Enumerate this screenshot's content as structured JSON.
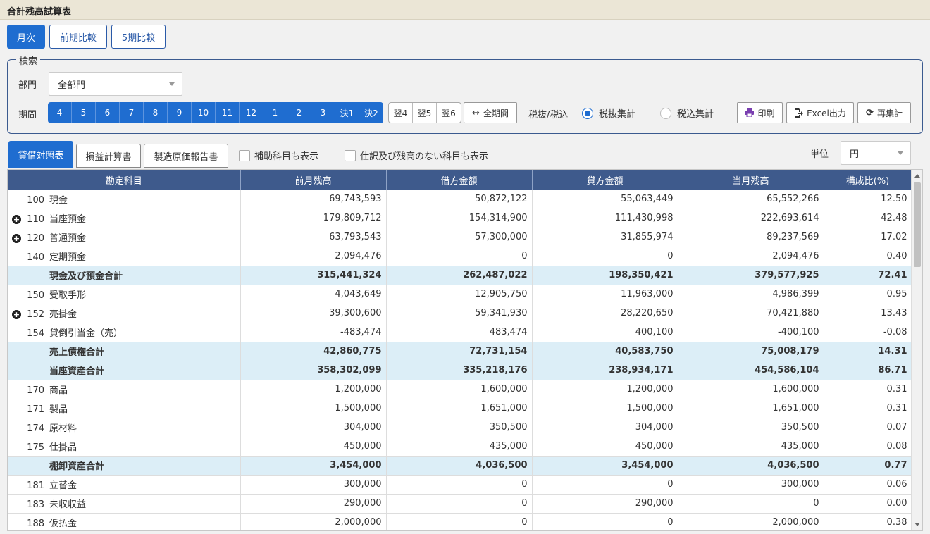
{
  "title": "合計残高試算表",
  "view_tabs": [
    "月次",
    "前期比較",
    "5期比較"
  ],
  "search": {
    "legend": "検索",
    "department_label": "部門",
    "department_value": "全部門",
    "period_label": "期間",
    "periods": [
      "4",
      "5",
      "6",
      "7",
      "8",
      "9",
      "10",
      "11",
      "12",
      "1",
      "2",
      "3",
      "決1",
      "決2"
    ],
    "periods_next": [
      "翌4",
      "翌5",
      "翌6"
    ],
    "all_period_label": "全期間",
    "tax_label": "税抜/税込",
    "tax_options": [
      "税抜集計",
      "税込集計"
    ],
    "tax_selected": 0,
    "print_label": "印刷",
    "excel_label": "Excel出力",
    "recalc_label": "再集計"
  },
  "report_tabs": [
    "貸借対照表",
    "損益計算書",
    "製造原価報告書"
  ],
  "options": {
    "sub_accounts": "補助科目も表示",
    "no_journal": "仕訳及び残高のない科目も表示"
  },
  "unit": {
    "label": "単位",
    "value": "円"
  },
  "table": {
    "headers": [
      "勘定科目",
      "前月残高",
      "借方金額",
      "貸方金額",
      "当月残高",
      "構成比(%)"
    ],
    "rows": [
      {
        "code": "100",
        "name": "現金",
        "expand": false,
        "subtotal": false,
        "values": [
          "69,743,593",
          "50,872,122",
          "55,063,449",
          "65,552,266",
          "12.50"
        ]
      },
      {
        "code": "110",
        "name": "当座預金",
        "expand": true,
        "subtotal": false,
        "values": [
          "179,809,712",
          "154,314,900",
          "111,430,998",
          "222,693,614",
          "42.48"
        ]
      },
      {
        "code": "120",
        "name": "普通預金",
        "expand": true,
        "subtotal": false,
        "values": [
          "63,793,543",
          "57,300,000",
          "31,855,974",
          "89,237,569",
          "17.02"
        ]
      },
      {
        "code": "140",
        "name": "定期預金",
        "expand": false,
        "subtotal": false,
        "values": [
          "2,094,476",
          "0",
          "0",
          "2,094,476",
          "0.40"
        ]
      },
      {
        "code": "",
        "name": "現金及び預金合計",
        "expand": false,
        "subtotal": true,
        "values": [
          "315,441,324",
          "262,487,022",
          "198,350,421",
          "379,577,925",
          "72.41"
        ]
      },
      {
        "code": "150",
        "name": "受取手形",
        "expand": false,
        "subtotal": false,
        "values": [
          "4,043,649",
          "12,905,750",
          "11,963,000",
          "4,986,399",
          "0.95"
        ]
      },
      {
        "code": "152",
        "name": "売掛金",
        "expand": true,
        "subtotal": false,
        "values": [
          "39,300,600",
          "59,341,930",
          "28,220,650",
          "70,421,880",
          "13.43"
        ]
      },
      {
        "code": "154",
        "name": "貸倒引当金（売）",
        "expand": false,
        "subtotal": false,
        "values": [
          "-483,474",
          "483,474",
          "400,100",
          "-400,100",
          "-0.08"
        ]
      },
      {
        "code": "",
        "name": "売上債権合計",
        "expand": false,
        "subtotal": true,
        "values": [
          "42,860,775",
          "72,731,154",
          "40,583,750",
          "75,008,179",
          "14.31"
        ]
      },
      {
        "code": "",
        "name": "当座資産合計",
        "expand": false,
        "subtotal": true,
        "values": [
          "358,302,099",
          "335,218,176",
          "238,934,171",
          "454,586,104",
          "86.71"
        ]
      },
      {
        "code": "170",
        "name": "商品",
        "expand": false,
        "subtotal": false,
        "values": [
          "1,200,000",
          "1,600,000",
          "1,200,000",
          "1,600,000",
          "0.31"
        ]
      },
      {
        "code": "171",
        "name": "製品",
        "expand": false,
        "subtotal": false,
        "values": [
          "1,500,000",
          "1,651,000",
          "1,500,000",
          "1,651,000",
          "0.31"
        ]
      },
      {
        "code": "174",
        "name": "原材料",
        "expand": false,
        "subtotal": false,
        "values": [
          "304,000",
          "350,500",
          "304,000",
          "350,500",
          "0.07"
        ]
      },
      {
        "code": "175",
        "name": "仕掛品",
        "expand": false,
        "subtotal": false,
        "values": [
          "450,000",
          "435,000",
          "450,000",
          "435,000",
          "0.08"
        ]
      },
      {
        "code": "",
        "name": "棚卸資産合計",
        "expand": false,
        "subtotal": true,
        "values": [
          "3,454,000",
          "4,036,500",
          "3,454,000",
          "4,036,500",
          "0.77"
        ]
      },
      {
        "code": "181",
        "name": "立替金",
        "expand": false,
        "subtotal": false,
        "values": [
          "300,000",
          "0",
          "0",
          "300,000",
          "0.06"
        ]
      },
      {
        "code": "183",
        "name": "未収収益",
        "expand": false,
        "subtotal": false,
        "values": [
          "290,000",
          "0",
          "290,000",
          "0",
          "0.00"
        ]
      },
      {
        "code": "188",
        "name": "仮払金",
        "expand": false,
        "subtotal": false,
        "values": [
          "2,000,000",
          "0",
          "0",
          "2,000,000",
          "0.38"
        ]
      }
    ]
  }
}
